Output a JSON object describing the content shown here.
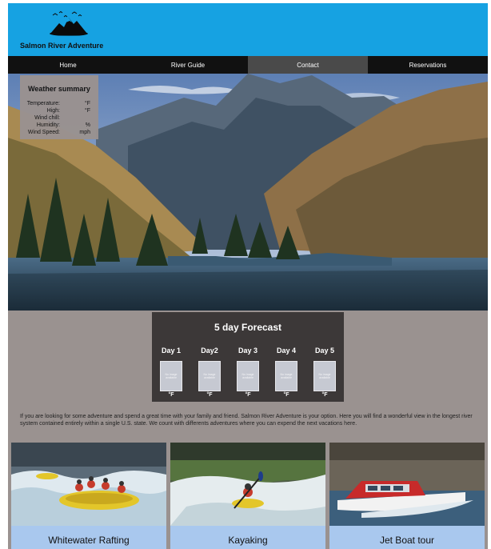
{
  "brand": {
    "name": "Salmon River Adventure"
  },
  "nav": [
    "Home",
    "River Guide",
    "Contact",
    "Reservations"
  ],
  "weather": {
    "title": "Weather summary",
    "rows": [
      {
        "label": "Temperature:",
        "unit": "°F"
      },
      {
        "label": "High:",
        "unit": "°F"
      },
      {
        "label": "Wind chill:",
        "unit": ""
      },
      {
        "label": "Humidity:",
        "unit": "%"
      },
      {
        "label": "Wind Speed:",
        "unit": "mph"
      }
    ]
  },
  "forecast": {
    "title": "5 day Forecast",
    "days": [
      {
        "label": "Day 1",
        "image_text": "No image available",
        "temp": "°F"
      },
      {
        "label": "Day2",
        "image_text": "No image available",
        "temp": "°F"
      },
      {
        "label": "Day 3",
        "image_text": "No image available",
        "temp": "°F"
      },
      {
        "label": "Day 4",
        "image_text": "No image available",
        "temp": "°F"
      },
      {
        "label": "Day 5",
        "image_text": "No image available",
        "temp": "°F"
      }
    ]
  },
  "intro": "If you are looking for some adventure and spend a great time with your family and friend. Salmon River Adventure is your option. Here you will find a wonderful view in the longest river system contained entirely within a single U.S. state. We count with differents adventures where you can expend the next vacations here.",
  "cards": [
    "Whitewater Rafting",
    "Kayaking",
    "Jet Boat tour"
  ],
  "colors": {
    "header": "#16a2e2",
    "nav": "#111111",
    "nav_active": "#4a4a4a",
    "page_bg": "#9a9290",
    "forecast_bg": "#3c3838",
    "caption_bg": "#a9c8ee"
  }
}
